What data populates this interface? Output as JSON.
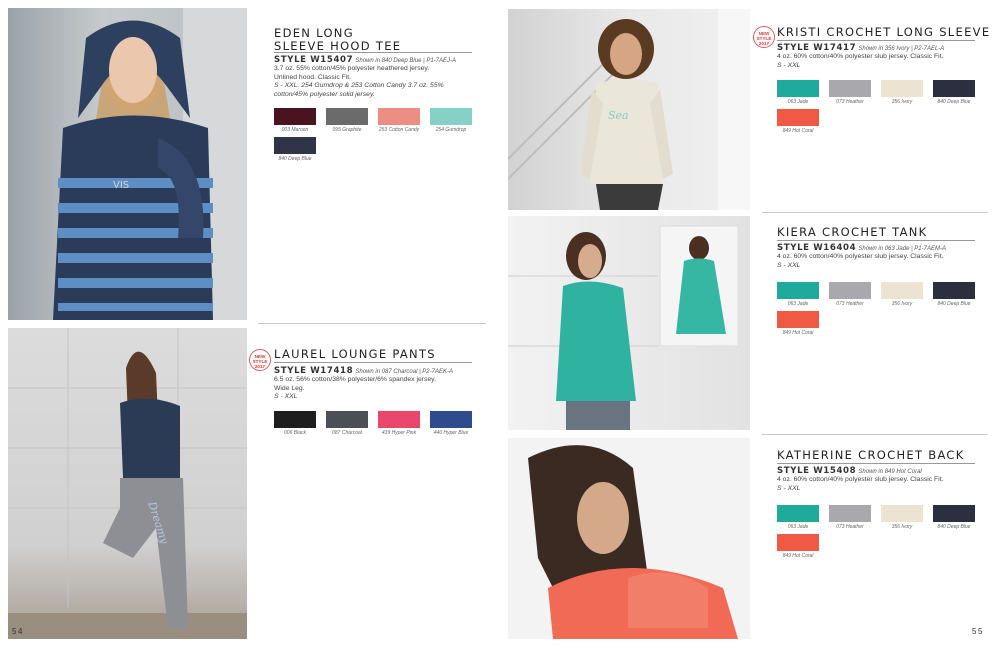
{
  "pages": {
    "left": "54",
    "right": "55"
  },
  "badge": {
    "line1": "NEW",
    "line2": "STYLE",
    "line3": "2017"
  },
  "eden": {
    "title_line1": "EDEN LONG",
    "title_line2": "SLEEVE HOOD TEE",
    "style": "STYLE W15407",
    "shown": "Shown in 840 Deep Blue | P1-7AEJ-A",
    "desc1": "3.7 oz. 55% cotton/45% polyester heathered jersey.",
    "desc2": "Unlined hood. Classic Fit.",
    "sizes": "S - XXL. 254 Gumdrop & 253 Cotton Candy 3.7 oz. 55% cotton/45% polyester solid jersey.",
    "swatches": [
      {
        "label": "003 Maroon",
        "color": "#4a1320"
      },
      {
        "label": "095 Graphite",
        "color": "#6b6b6b"
      },
      {
        "label": "253 Cotton Candy",
        "color": "#ec8e83"
      },
      {
        "label": "254 Gumdrop",
        "color": "#86d1c5"
      },
      {
        "label": "840 Deep Blue",
        "color": "#2f3446"
      }
    ]
  },
  "laurel": {
    "title": "LAUREL LOUNGE PANTS",
    "style": "STYLE W17418",
    "shown": "Shown in 087 Charcoal | P2-7AEK-A",
    "desc1": "6.5 oz. 56% cotton/38% polyester/6% spandex jersey.",
    "desc2": "Wide Leg.",
    "sizes": "S - XXL",
    "swatches": [
      {
        "label": "006 Black",
        "color": "#1e1e1e"
      },
      {
        "label": "087 Charcoal",
        "color": "#4c4f55"
      },
      {
        "label": "439 Hyper Pink",
        "color": "#e8476b"
      },
      {
        "label": "440 Hyper Blue",
        "color": "#2e4b8e"
      }
    ]
  },
  "kristi": {
    "title": "KRISTI CROCHET LONG SLEEVE",
    "style": "STYLE W17417",
    "shown": "Shown in 356 Ivory | P2-7AEL-A",
    "desc1": "4 oz. 60% cotton/40% polyester slub jersey. Classic Fit.",
    "sizes": "S - XXL",
    "swatches": [
      {
        "label": "063 Jade",
        "color": "#1eab9b"
      },
      {
        "label": "073 Heather",
        "color": "#a9a9ad"
      },
      {
        "label": "356 Ivory",
        "color": "#ece3d3"
      },
      {
        "label": "840 Deep Blue",
        "color": "#2b2f40"
      },
      {
        "label": "849 Hot Coral",
        "color": "#f05a45"
      }
    ]
  },
  "kiera": {
    "title": "KIERA CROCHET TANK",
    "style": "STYLE W16404",
    "shown": "Shown in 063 Jade | P1-7AEM-A",
    "desc1": "4 oz. 60% cotton/40% polyester slub jersey. Classic Fit.",
    "sizes": "S - XXL",
    "swatches": [
      {
        "label": "063 Jade",
        "color": "#1eab9b"
      },
      {
        "label": "073 Heather",
        "color": "#a9a9ad"
      },
      {
        "label": "356 Ivory",
        "color": "#ece3d3"
      },
      {
        "label": "840 Deep Blue",
        "color": "#2b2f40"
      },
      {
        "label": "849 Hot Coral",
        "color": "#f05a45"
      }
    ]
  },
  "katherine": {
    "title": "KATHERINE CROCHET BACK",
    "style": "STYLE W15408",
    "shown": "Shown in 849 Hot Coral",
    "desc1": "4 oz. 60% cotton/40% polyester slub jersey. Classic Fit.",
    "sizes": "S - XXL",
    "swatches": [
      {
        "label": "063 Jade",
        "color": "#1eab9b"
      },
      {
        "label": "073 Heather",
        "color": "#a9a9ad"
      },
      {
        "label": "356 Ivory",
        "color": "#ece3d3"
      },
      {
        "label": "840 Deep Blue",
        "color": "#2b2f40"
      },
      {
        "label": "849 Hot Coral",
        "color": "#f05a45"
      }
    ]
  }
}
